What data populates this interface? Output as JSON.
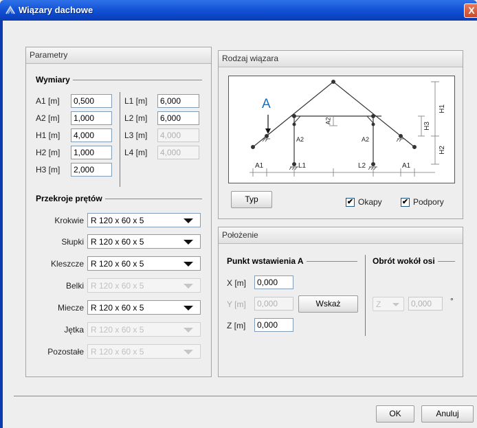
{
  "window": {
    "title": "Wiązary dachowe",
    "close_label": "X"
  },
  "parametry": {
    "header": "Parametry",
    "wymiary": {
      "title": "Wymiary",
      "fields": [
        {
          "label": "A1 [m]",
          "value": "0,500"
        },
        {
          "label": "A2 [m]",
          "value": "1,000"
        },
        {
          "label": "H1 [m]",
          "value": "4,000"
        },
        {
          "label": "H2 [m]",
          "value": "1,000"
        },
        {
          "label": "H3 [m]",
          "value": "2,000"
        },
        {
          "label": "L1 [m]",
          "value": "6,000"
        },
        {
          "label": "L2 [m]",
          "value": "6,000"
        },
        {
          "label": "L3 [m]",
          "value": "4,000"
        },
        {
          "label": "L4 [m]",
          "value": "4,000"
        }
      ]
    },
    "przekroje": {
      "title": "Przekroje prętów",
      "rows": [
        {
          "label": "Krokwie",
          "value": "R 120 x 60 x 5",
          "enabled": true
        },
        {
          "label": "Słupki",
          "value": "R 120 x 60 x 5",
          "enabled": true
        },
        {
          "label": "Kleszcze",
          "value": "R 120 x 60 x 5",
          "enabled": true
        },
        {
          "label": "Belki",
          "value": "R 120 x 60 x 5",
          "enabled": false
        },
        {
          "label": "Miecze",
          "value": "R 120 x 60 x 5",
          "enabled": true
        },
        {
          "label": "Jętka",
          "value": "R 120 x 60 x 5",
          "enabled": false
        },
        {
          "label": "Pozostałe",
          "value": "R 120 x 60 x 5",
          "enabled": false
        }
      ]
    }
  },
  "rodzaj": {
    "header": "Rodzaj wiązara",
    "typ_button": "Typ",
    "okapy_label": "Okapy",
    "podpory_label": "Podpory",
    "check_mark": "✔",
    "diagram_labels": {
      "a_marker": "A",
      "a1": "A1",
      "a1_right": "A1",
      "a2": "A2",
      "a2_left": "A2",
      "a2_right": "A2",
      "l1": "L1",
      "l2": "L2",
      "h1": "H1",
      "h2": "H2",
      "h3": "H3"
    },
    "accent": "#1a6ab5"
  },
  "polozenie": {
    "header": "Położenie",
    "punkt_title": "Punkt wstawienia A",
    "obrot_title": "Obrót wokół osi",
    "x_label": "X [m]",
    "x_value": "0,000",
    "y_label": "Y [m]",
    "y_value": "0,000",
    "z_label": "Z [m]",
    "z_value": "0,000",
    "wskaz_button": "Wskaż",
    "axis_value": "Z",
    "angle_value": "0,000",
    "degree": "°"
  },
  "footer": {
    "ok": "OK",
    "anuluj": "Anuluj"
  }
}
